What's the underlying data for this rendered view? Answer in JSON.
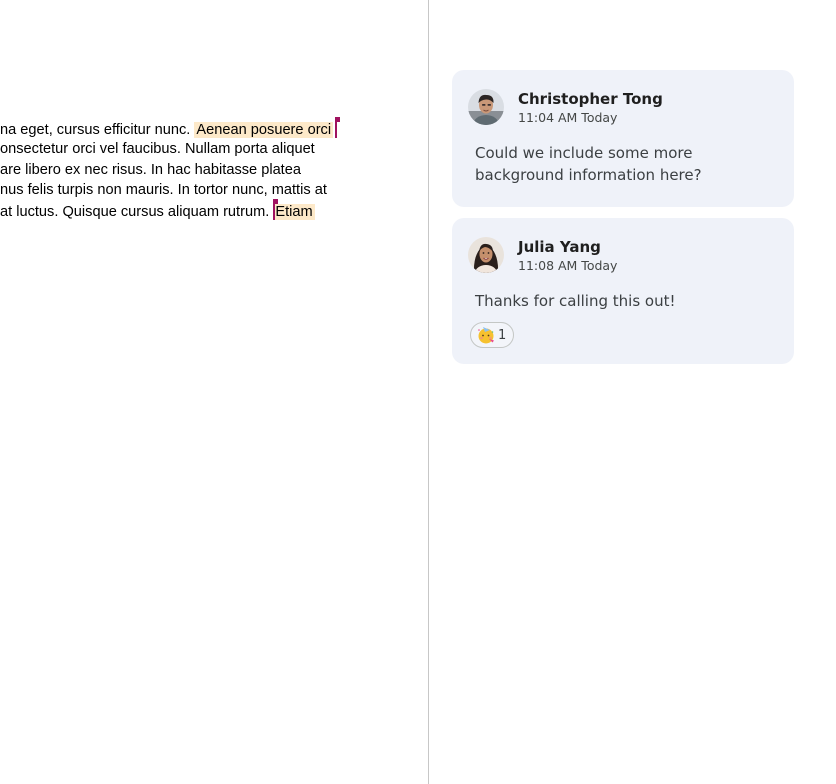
{
  "document": {
    "lines": [
      {
        "pre": "na eget, cursus efficitur nunc. ",
        "highlight": "Aenean posuere orci"
      },
      {
        "text": "onsectetur orci vel faucibus. Nullam porta aliquet"
      },
      {
        "text": "are libero ex nec risus. In hac habitasse platea"
      },
      {
        "text": "nus felis turpis non mauris. In tortor nunc, mattis at"
      },
      {
        "pre": "at luctus. Quisque cursus aliquam rutrum. ",
        "highlight": "Etiam"
      }
    ],
    "highlight_color": "#fde9c9",
    "cursor_color": "#a0125f"
  },
  "comments": [
    {
      "author": "Christopher Tong",
      "time": "11:04 AM Today",
      "text": "Could we include some more background information here?",
      "avatar": "person-avatar-male"
    },
    {
      "author": "Julia Yang",
      "time": "11:08 AM Today",
      "text": "Thanks for calling this out!",
      "avatar": "person-avatar-female",
      "reaction": {
        "icon": "party-face-emoji-icon",
        "count": "1"
      }
    }
  ],
  "card_color": "#eff2f9"
}
